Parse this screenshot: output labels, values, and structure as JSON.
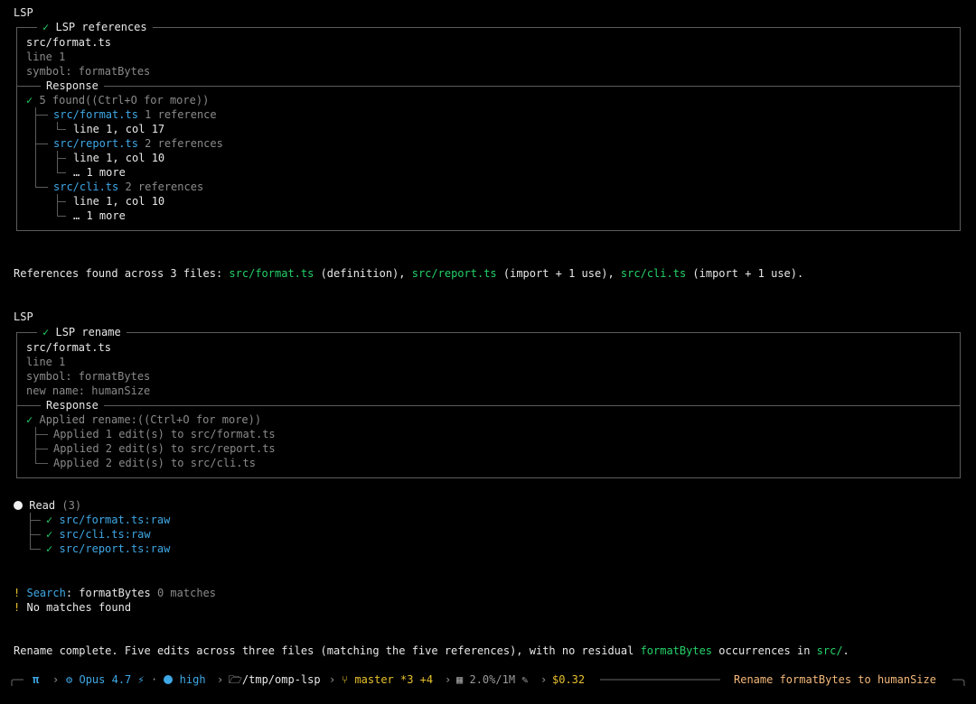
{
  "lsp_refs": {
    "section_label": "LSP",
    "title": "LSP references",
    "file": "src/format.ts",
    "line": "line 1",
    "symbol": "symbol: formatBytes",
    "response_label": "Response",
    "summary": "5 found((Ctrl+O for more))",
    "files": [
      {
        "name": "src/format.ts",
        "count": "1 reference",
        "entries": [
          "line 1, col 17"
        ]
      },
      {
        "name": "src/report.ts",
        "count": "2 references",
        "entries": [
          "line 1, col 10",
          "… 1 more"
        ]
      },
      {
        "name": "src/cli.ts",
        "count": "2 references",
        "entries": [
          "line 1, col 10",
          "… 1 more"
        ]
      }
    ]
  },
  "message1": {
    "prefix": "References found across 3 files: ",
    "f1": "src/format.ts",
    "t1": " (definition), ",
    "f2": "src/report.ts",
    "t2": " (import + 1 use), ",
    "f3": "src/cli.ts",
    "t3": " (import + 1 use)."
  },
  "lsp_rename": {
    "section_label": "LSP",
    "title": "LSP rename",
    "file": "src/format.ts",
    "line": "line 1",
    "symbol": "symbol: formatBytes",
    "new_name": "new name: humanSize",
    "response_label": "Response",
    "summary": "Applied rename:((Ctrl+O for more))",
    "edits": [
      "Applied 1 edit(s) to src/format.ts",
      "Applied 2 edit(s) to src/report.ts",
      "Applied 2 edit(s) to src/cli.ts"
    ]
  },
  "read": {
    "label": "Read",
    "count": "(3)",
    "items": [
      "src/format.ts:raw",
      "src/cli.ts:raw",
      "src/report.ts:raw"
    ]
  },
  "search": {
    "bang": "!",
    "label": "Search",
    "colon": ": formatBytes",
    "result": "0 matches",
    "message": "No matches found"
  },
  "message2": {
    "prefix": "Rename complete. Five edits across three files (matching the five references), with no residual ",
    "symbol": "formatBytes",
    "mid": " occurrences in ",
    "dir": "src/",
    "end": "."
  },
  "statusbar": {
    "pi": "π",
    "model": "Opus 4.7",
    "bolt": "⚡",
    "sep": "·",
    "effort": "high",
    "path": "/tmp/omp-lsp",
    "branch": "master *3 +4",
    "context": "2.0%/1M",
    "cost": "$0.32",
    "task": "Rename formatBytes to humanSize"
  },
  "colors": {
    "accent_blue": "#3fa8e6",
    "success_green": "#25d169",
    "warning_yellow": "#e8c12c",
    "task_orange": "#f5b97a"
  }
}
